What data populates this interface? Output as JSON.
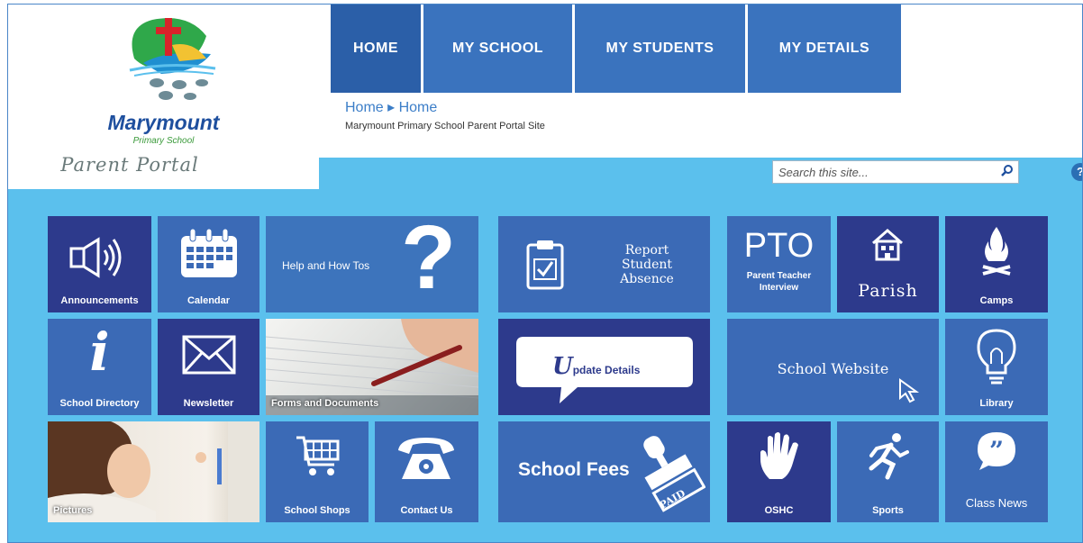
{
  "school": {
    "name": "Marymount",
    "subtitle": "Primary School",
    "portal": "Parent Portal"
  },
  "nav": {
    "tabs": [
      {
        "label": "HOME",
        "active": true
      },
      {
        "label": "MY SCHOOL"
      },
      {
        "label": "MY STUDENTS"
      },
      {
        "label": "MY DETAILS"
      }
    ]
  },
  "breadcrumb": {
    "path": "Home ▸ Home",
    "description": "Marymount Primary School Parent Portal Site"
  },
  "search": {
    "placeholder": "Search this site...",
    "icon": "search-icon"
  },
  "help": {
    "label": "?"
  },
  "tiles": {
    "announcements": "Announcements",
    "calendar": "Calendar",
    "help_how_tos": "Help and How Tos",
    "report_absence": [
      "Report",
      "Student",
      "Absence"
    ],
    "pto_title": "PTO",
    "pto_sub": [
      "Parent Teacher",
      "Interview"
    ],
    "parish": "Parish",
    "camps": "Camps",
    "school_directory": "School Directory",
    "newsletter": "Newsletter",
    "forms_documents": "Forms and Documents",
    "update_details": "pdate Details",
    "update_initial": "U",
    "school_website": "School Website",
    "library": "Library",
    "pictures": "Pictures",
    "school_shops": "School Shops",
    "contact_us": "Contact Us",
    "school_fees": "School Fees",
    "paid_stamp": "PAID",
    "oshc": "OSHC",
    "sports": "Sports",
    "class_news": "Class News"
  },
  "colors": {
    "background": "#5bc0ed",
    "tile_dark": "#2d3a8c",
    "tile_mid": "#3b6ab6",
    "nav": "#3a73be"
  }
}
